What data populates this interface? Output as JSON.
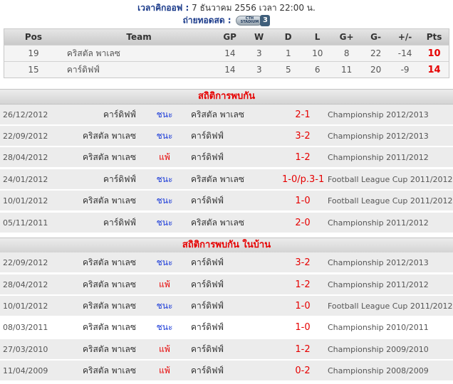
{
  "kickoff": {
    "label": "เวลาคิกออฟ :",
    "value": "7 ธันวาคม 2556 เวลา 22:00 น."
  },
  "broadcast": {
    "label": "ถ่ายทอดสด :",
    "channel_text": "CTH STADIUM",
    "channel_num": "3",
    "icon": "tv-channel-logo-icon"
  },
  "standings": {
    "headers": {
      "pos": "Pos",
      "team": "Team",
      "gp": "GP",
      "w": "W",
      "d": "D",
      "l": "L",
      "gf": "G+",
      "ga": "G-",
      "gd": "+/-",
      "pts": "Pts"
    },
    "rows": [
      {
        "pos": "19",
        "team": "คริสตัล พาเลซ",
        "gp": "14",
        "w": "3",
        "d": "1",
        "l": "10",
        "gf": "8",
        "ga": "22",
        "gd": "-14",
        "pts": "10"
      },
      {
        "pos": "15",
        "team": "คาร์ดิฟฟ์",
        "gp": "14",
        "w": "3",
        "d": "5",
        "l": "6",
        "gf": "11",
        "ga": "20",
        "gd": "-9",
        "pts": "14"
      }
    ]
  },
  "h2h": {
    "title": "สถิติการพบกัน",
    "rows": [
      {
        "date": "26/12/2012",
        "home": "คาร์ดิฟฟ์",
        "result": "ชนะ",
        "outcome": "win",
        "away": "คริสตัล พาเลซ",
        "score": "2-1",
        "competition": "Championship 2012/2013"
      },
      {
        "date": "22/09/2012",
        "home": "คริสตัล พาเลซ",
        "result": "ชนะ",
        "outcome": "win",
        "away": "คาร์ดิฟฟ์",
        "score": "3-2",
        "competition": "Championship 2012/2013"
      },
      {
        "date": "28/04/2012",
        "home": "คริสตัล พาเลซ",
        "result": "แพ้",
        "outcome": "lose",
        "away": "คาร์ดิฟฟ์",
        "score": "1-2",
        "competition": "Championship 2011/2012"
      },
      {
        "date": "24/01/2012",
        "home": "คาร์ดิฟฟ์",
        "result": "ชนะ",
        "outcome": "win",
        "away": "คริสตัล พาเลซ",
        "score": "1-0/p.3-1",
        "competition": "Football League Cup 2011/2012"
      },
      {
        "date": "10/01/2012",
        "home": "คริสตัล พาเลซ",
        "result": "ชนะ",
        "outcome": "win",
        "away": "คาร์ดิฟฟ์",
        "score": "1-0",
        "competition": "Football League Cup 2011/2012"
      },
      {
        "date": "05/11/2011",
        "home": "คาร์ดิฟฟ์",
        "result": "ชนะ",
        "outcome": "win",
        "away": "คริสตัล พาเลซ",
        "score": "2-0",
        "competition": "Championship 2011/2012"
      }
    ]
  },
  "home_h2h": {
    "title": "สถิติการพบกัน ในบ้าน",
    "rows": [
      {
        "date": "22/09/2012",
        "home": "คริสตัล พาเลซ",
        "result": "ชนะ",
        "outcome": "win",
        "away": "คาร์ดิฟฟ์",
        "score": "3-2",
        "competition": "Championship 2012/2013"
      },
      {
        "date": "28/04/2012",
        "home": "คริสตัล พาเลซ",
        "result": "แพ้",
        "outcome": "lose",
        "away": "คาร์ดิฟฟ์",
        "score": "1-2",
        "competition": "Championship 2011/2012"
      },
      {
        "date": "10/01/2012",
        "home": "คริสตัล พาเลซ",
        "result": "ชนะ",
        "outcome": "win",
        "away": "คาร์ดิฟฟ์",
        "score": "1-0",
        "competition": "Football League Cup 2011/2012"
      },
      {
        "date": "08/03/2011",
        "home": "คริสตัล พาเลซ",
        "result": "ชนะ",
        "outcome": "win",
        "away": "คาร์ดิฟฟ์",
        "score": "1-0",
        "competition": "Championship 2010/2011"
      },
      {
        "date": "27/03/2010",
        "home": "คริสตัล พาเลซ",
        "result": "แพ้",
        "outcome": "lose",
        "away": "คาร์ดิฟฟ์",
        "score": "1-2",
        "competition": "Championship 2009/2010"
      },
      {
        "date": "11/04/2009",
        "home": "คริสตัล พาเลซ",
        "result": "แพ้",
        "outcome": "lose",
        "away": "คาร์ดิฟฟ์",
        "score": "0-2",
        "competition": "Championship 2008/2009"
      }
    ]
  },
  "colors": {
    "win": "#1a3ad8",
    "lose": "#e60000",
    "accent_red": "#e60000",
    "label_blue": "#1a3a8a"
  }
}
